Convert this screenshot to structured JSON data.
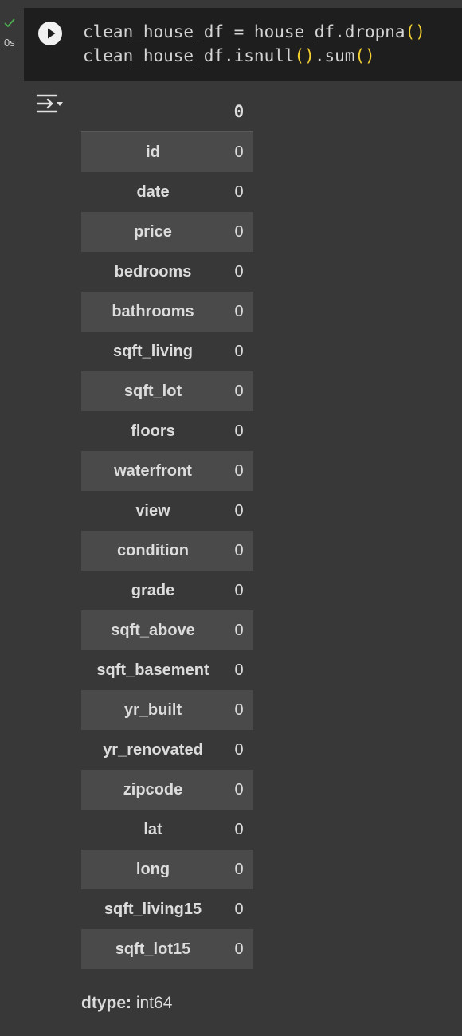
{
  "cell": {
    "status": "success",
    "exec_time": "0s",
    "code_lines": [
      {
        "before": "clean_house_df = house_df.dropna",
        "parens": "()",
        "after": ""
      },
      {
        "before": "clean_house_df.isnull",
        "parens": "()",
        "after": ".sum",
        "parens2": "()"
      }
    ]
  },
  "output": {
    "column_header": "0",
    "rows": [
      {
        "name": "id",
        "value": "0"
      },
      {
        "name": "date",
        "value": "0"
      },
      {
        "name": "price",
        "value": "0"
      },
      {
        "name": "bedrooms",
        "value": "0"
      },
      {
        "name": "bathrooms",
        "value": "0"
      },
      {
        "name": "sqft_living",
        "value": "0"
      },
      {
        "name": "sqft_lot",
        "value": "0"
      },
      {
        "name": "floors",
        "value": "0"
      },
      {
        "name": "waterfront",
        "value": "0"
      },
      {
        "name": "view",
        "value": "0"
      },
      {
        "name": "condition",
        "value": "0"
      },
      {
        "name": "grade",
        "value": "0"
      },
      {
        "name": "sqft_above",
        "value": "0"
      },
      {
        "name": "sqft_basement",
        "value": "0"
      },
      {
        "name": "yr_built",
        "value": "0"
      },
      {
        "name": "yr_renovated",
        "value": "0"
      },
      {
        "name": "zipcode",
        "value": "0"
      },
      {
        "name": "lat",
        "value": "0"
      },
      {
        "name": "long",
        "value": "0"
      },
      {
        "name": "sqft_living15",
        "value": "0"
      },
      {
        "name": "sqft_lot15",
        "value": "0"
      }
    ],
    "dtype_label": "dtype:",
    "dtype_value": " int64"
  },
  "icons": {
    "status": "checkmark-icon",
    "run": "play-icon",
    "output_actions": "output-actions-icon"
  },
  "colors": {
    "background": "#383838",
    "code_background": "#1e1e1e",
    "paren": "#f5d131",
    "success": "#4caf50",
    "striped_row": "#4a4a4a"
  }
}
